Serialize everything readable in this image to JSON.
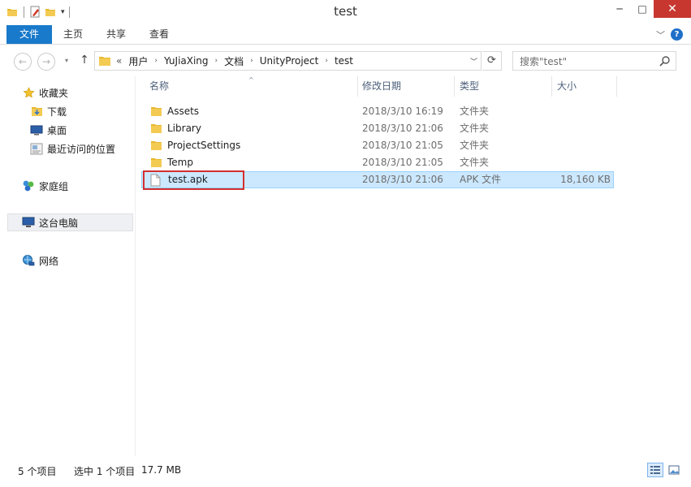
{
  "window": {
    "title": "test",
    "controls": {
      "minimize": "─",
      "maximize": "□",
      "close": "✕"
    }
  },
  "ribbon": {
    "tabs": [
      {
        "label": "文件",
        "active": true
      },
      {
        "label": "主页"
      },
      {
        "label": "共享"
      },
      {
        "label": "查看"
      }
    ],
    "help": "?"
  },
  "address": {
    "back": "←",
    "forward": "→",
    "up": "↑",
    "overflow": "«",
    "crumbs": [
      "用户",
      "YuJiaXing",
      "文档",
      "UnityProject",
      "test"
    ],
    "refresh": "⟳"
  },
  "search": {
    "placeholder": "搜索\"test\""
  },
  "nav": {
    "favorites": "收藏夹",
    "downloads": "下载",
    "desktop": "桌面",
    "recent": "最近访问的位置",
    "homegroup": "家庭组",
    "thispc": "这台电脑",
    "network": "网络"
  },
  "columns": {
    "name": "名称",
    "date": "修改日期",
    "type": "类型",
    "size": "大小"
  },
  "files": [
    {
      "name": "Assets",
      "date": "2018/3/10 16:19",
      "type": "文件夹",
      "size": "",
      "kind": "folder"
    },
    {
      "name": "Library",
      "date": "2018/3/10 21:06",
      "type": "文件夹",
      "size": "",
      "kind": "folder"
    },
    {
      "name": "ProjectSettings",
      "date": "2018/3/10 21:05",
      "type": "文件夹",
      "size": "",
      "kind": "folder"
    },
    {
      "name": "Temp",
      "date": "2018/3/10 21:05",
      "type": "文件夹",
      "size": "",
      "kind": "folder"
    },
    {
      "name": "test.apk",
      "date": "2018/3/10 21:06",
      "type": "APK 文件",
      "size": "18,160 KB",
      "kind": "file",
      "selected": true
    }
  ],
  "status": {
    "item_count": "5 个项目",
    "selection": "选中 1 个项目",
    "selection_size": "17.7 MB"
  },
  "colors": {
    "accent": "#1979ca",
    "selection_bg": "#cce8ff",
    "selection_border": "#99d1ff",
    "highlight": "#d32f2f",
    "close": "#c7372f",
    "folder": "#e8b830"
  }
}
